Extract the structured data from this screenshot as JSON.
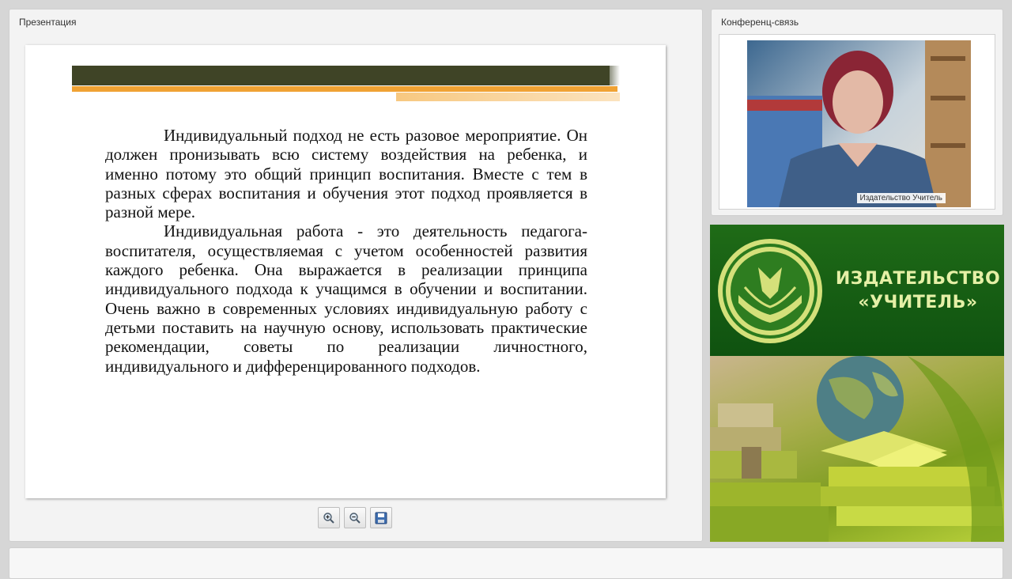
{
  "presentation": {
    "title": "Презентация",
    "paragraphs": [
      "Индивидуальный подход не есть разовое мероприятие. Он должен пронизывать всю систему воздействия на ребенка, и именно потому это общий принцип воспитания. Вместе с тем в разных сферах воспитания и обучения этот подход проявляется в разной мере.",
      "Индивидуальная работа - это деятельность педагога-воспитателя, осуществляемая с учетом особенностей развития каждого ребенка. Она выражается в реализации принципа индивидуального подхода к учащимся в обучении и воспитании. Очень важно в современных условиях индивидуальную работу с детьми поставить на научную основу, использовать практические рекомендации, советы по реализации личностного, индивидуального и дифференцированного подходов."
    ],
    "toolbar": [
      "zoom-in-icon",
      "zoom-out-icon",
      "save-icon"
    ]
  },
  "conference": {
    "title": "Конференц-связь",
    "video_label": "Издательство Учитель"
  },
  "publisher": {
    "name_line1": "ИЗДАТЕЛЬСТВО",
    "name_line2": "«УЧИТЕЛЬ»"
  },
  "colors": {
    "band_dark": "#3f4426",
    "band_orange": "#f0a233",
    "logo_green": "#1f6b17",
    "logo_text": "#e5f0a6"
  }
}
